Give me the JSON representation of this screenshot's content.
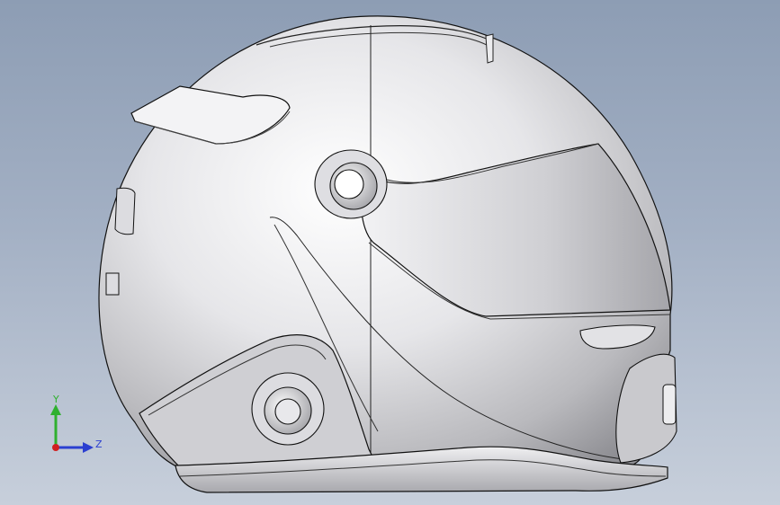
{
  "viewport": {
    "background_top": "#8d9db4",
    "background_bottom": "#c7cfdb"
  },
  "model": {
    "part_name": "helmet",
    "shell_color": "#d9d9dc",
    "edge_color": "#111111"
  },
  "triad": {
    "y_label": "Y",
    "z_label": "Z",
    "y_color": "#2fb02f",
    "z_color": "#2b3fd0",
    "x_color": "#d02020"
  }
}
